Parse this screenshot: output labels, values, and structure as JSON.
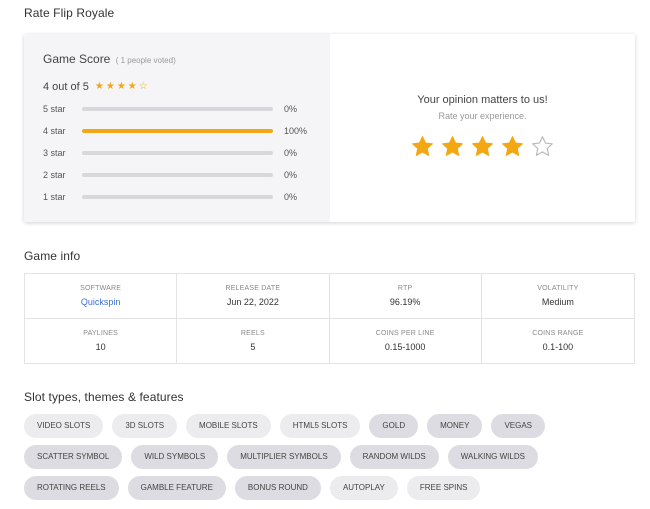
{
  "page": {
    "title": "Rate Flip Royale"
  },
  "score": {
    "heading": "Game Score",
    "votes": "( 1 people voted)",
    "average_text": "4 out of 5",
    "average_stars": 4,
    "max_stars": 5,
    "accent_color": "#f3a712",
    "rows": [
      {
        "label": "5 star",
        "percent_text": "0%",
        "fraction": 0
      },
      {
        "label": "4 star",
        "percent_text": "100%",
        "fraction": 1
      },
      {
        "label": "3 star",
        "percent_text": "0%",
        "fraction": 0
      },
      {
        "label": "2 star",
        "percent_text": "0%",
        "fraction": 0
      },
      {
        "label": "1 star",
        "percent_text": "0%",
        "fraction": 0
      }
    ]
  },
  "opinion": {
    "title": "Your opinion matters to us!",
    "subtitle": "Rate your experience.",
    "selected_stars": 4,
    "total_stars": 5
  },
  "game_info": {
    "title": "Game info",
    "cells": [
      {
        "label": "SOFTWARE",
        "value": "Quickspin",
        "link": true
      },
      {
        "label": "RELEASE DATE",
        "value": "Jun 22, 2022",
        "link": false
      },
      {
        "label": "RTP",
        "value": "96.19%",
        "link": false
      },
      {
        "label": "VOLATILITY",
        "value": "Medium",
        "link": false
      },
      {
        "label": "PAYLINES",
        "value": "10",
        "link": false
      },
      {
        "label": "REELS",
        "value": "5",
        "link": false
      },
      {
        "label": "COINS PER LINE",
        "value": "0.15-1000",
        "link": false
      },
      {
        "label": "COINS RANGE",
        "value": "0.1-100",
        "link": false
      }
    ]
  },
  "features": {
    "title": "Slot types, themes & features",
    "tags": [
      {
        "label": "VIDEO SLOTS",
        "dark": false
      },
      {
        "label": "3D SLOTS",
        "dark": false
      },
      {
        "label": "MOBILE SLOTS",
        "dark": false
      },
      {
        "label": "HTML5 SLOTS",
        "dark": false
      },
      {
        "label": "GOLD",
        "dark": true
      },
      {
        "label": "MONEY",
        "dark": true
      },
      {
        "label": "VEGAS",
        "dark": true
      },
      {
        "label": "SCATTER SYMBOL",
        "dark": true
      },
      {
        "label": "WILD SYMBOLS",
        "dark": true
      },
      {
        "label": "MULTIPLIER SYMBOLS",
        "dark": true
      },
      {
        "label": "RANDOM WILDS",
        "dark": true
      },
      {
        "label": "WALKING WILDS",
        "dark": true
      },
      {
        "label": "ROTATING REELS",
        "dark": true
      },
      {
        "label": "GAMBLE FEATURE",
        "dark": true
      },
      {
        "label": "BONUS ROUND",
        "dark": true
      },
      {
        "label": "AUTOPLAY",
        "dark": false
      },
      {
        "label": "FREE SPINS",
        "dark": false
      }
    ]
  }
}
